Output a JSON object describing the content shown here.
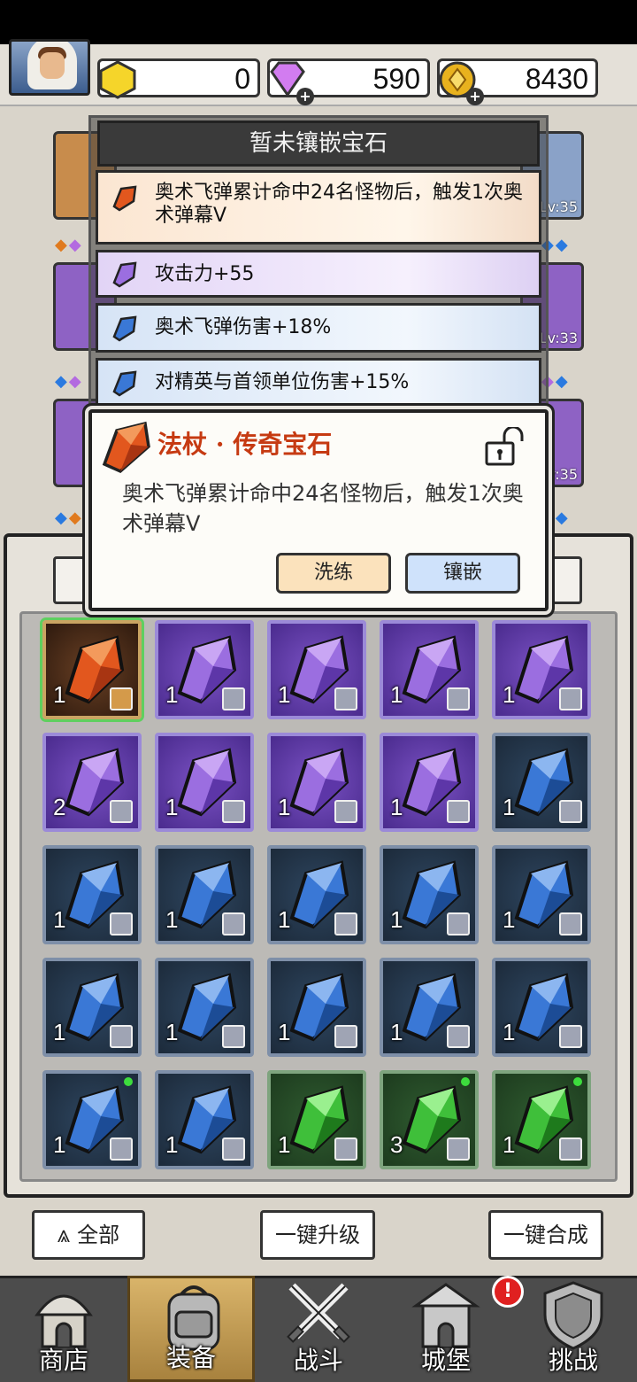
{
  "header": {
    "currencies": [
      {
        "icon": "gold-hexagon-icon",
        "value": "0"
      },
      {
        "icon": "purple-diamond-icon",
        "value": "590"
      },
      {
        "icon": "gold-coin-icon",
        "value": "8430"
      }
    ],
    "avatar": "hero-avatar"
  },
  "background_slots": {
    "left_levels": [],
    "right_levels": [
      "Lv:35",
      "Lv:33",
      "Lv:35"
    ]
  },
  "stat_panel": {
    "title": "暂未镶嵌宝石",
    "rows": [
      {
        "gem": "orange",
        "text": "奥术飞弹累计命中24名怪物后，触发1次奥术弹幕V"
      },
      {
        "gem": "purple",
        "text": "攻击力+55"
      },
      {
        "gem": "blue",
        "text": "奥术飞弹伤害+18%"
      },
      {
        "gem": "blue",
        "text": "对精英与首领单位伤害+15%"
      }
    ]
  },
  "popup": {
    "title": "法杖 · 传奇宝石",
    "description": "奥术飞弹累计命中24名怪物后，触发1次奥术弹幕V",
    "buttons": {
      "refine": "洗练",
      "inlay": "镶嵌"
    },
    "lock_icon": "unlock-icon"
  },
  "inventory": {
    "items": [
      {
        "color": "orange",
        "qty": "1",
        "slot": "staff",
        "selected": true
      },
      {
        "color": "purple",
        "qty": "1",
        "slot": "ring"
      },
      {
        "color": "purple",
        "qty": "1",
        "slot": "ring"
      },
      {
        "color": "purple",
        "qty": "1",
        "slot": "armor"
      },
      {
        "color": "purple",
        "qty": "1",
        "slot": "armor"
      },
      {
        "color": "purple",
        "qty": "2",
        "slot": "helmet"
      },
      {
        "color": "purple",
        "qty": "1",
        "slot": "amulet"
      },
      {
        "color": "purple",
        "qty": "1",
        "slot": "amulet"
      },
      {
        "color": "purple",
        "qty": "1",
        "slot": "amulet"
      },
      {
        "color": "blue",
        "qty": "1",
        "slot": "ring"
      },
      {
        "color": "blue",
        "qty": "1",
        "slot": "ring"
      },
      {
        "color": "blue",
        "qty": "1",
        "slot": "ring"
      },
      {
        "color": "blue",
        "qty": "1",
        "slot": "ring"
      },
      {
        "color": "blue",
        "qty": "1",
        "slot": "armor"
      },
      {
        "color": "blue",
        "qty": "1",
        "slot": "armor"
      },
      {
        "color": "blue",
        "qty": "1",
        "slot": "armor"
      },
      {
        "color": "blue",
        "qty": "1",
        "slot": "staff"
      },
      {
        "color": "blue",
        "qty": "1",
        "slot": "helmet"
      },
      {
        "color": "blue",
        "qty": "1",
        "slot": "helmet"
      },
      {
        "color": "blue",
        "qty": "1",
        "slot": "helmet"
      },
      {
        "color": "blue",
        "qty": "1",
        "slot": "helmet",
        "new": true
      },
      {
        "color": "blue",
        "qty": "1",
        "slot": "amulet"
      },
      {
        "color": "green",
        "qty": "1",
        "slot": "armor"
      },
      {
        "color": "green",
        "qty": "3",
        "slot": "armor",
        "new": true
      },
      {
        "color": "green",
        "qty": "1",
        "slot": "boots",
        "new": true
      }
    ]
  },
  "actions": {
    "filter": "全部",
    "upgrade_all": "一键升级",
    "merge_all": "一键合成"
  },
  "nav": {
    "items": [
      {
        "label": "商店",
        "icon": "shop-icon"
      },
      {
        "label": "装备",
        "icon": "backpack-icon",
        "active": true
      },
      {
        "label": "战斗",
        "icon": "crossed-swords-icon"
      },
      {
        "label": "城堡",
        "icon": "castle-icon"
      },
      {
        "label": "挑战",
        "icon": "shield-icon"
      }
    ],
    "alert": "!"
  },
  "colors": {
    "orange_gem": "#e2571e",
    "purple_gem": "#9b6ee0",
    "blue_gem": "#3a78d6",
    "green_gem": "#3fbf3a",
    "popup_title": "#c63a12"
  }
}
